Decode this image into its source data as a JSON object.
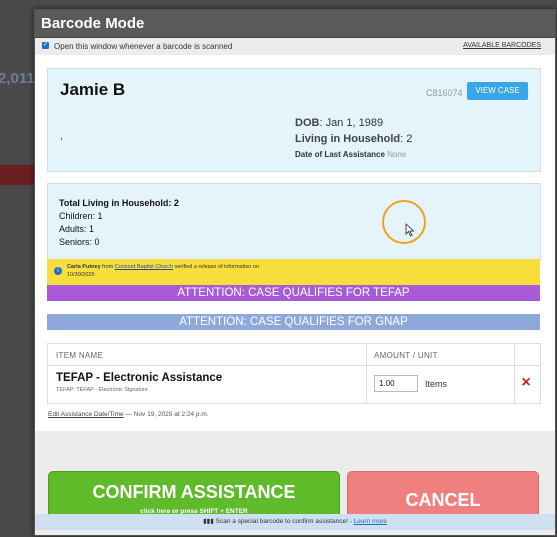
{
  "modal": {
    "title": "Barcode Mode",
    "open_window_label": "Open this window whenever a barcode is scanned",
    "available_barcodes": "AVAILABLE BARCODES"
  },
  "client": {
    "name": "Jamie B",
    "case_id": "C816074",
    "view_case": "VIEW CASE",
    "comma": ",",
    "dob_label": "DOB",
    "dob_value": ": Jan 1, 1989",
    "living_label": "Living in Household",
    "living_value": ": 2",
    "last_assistance_label": "Date of Last Assistance",
    "last_assistance_value": " None"
  },
  "household": {
    "total": "Total Living in Household: 2",
    "children": "Children: 1",
    "adults": "Adults: 1",
    "seniors": "Seniors: 0"
  },
  "notice": {
    "name": "Carla Putney",
    "from": " from ",
    "org": "Concord Baptist Church",
    "text": " verified a release of information on 10/30/2025"
  },
  "attention": {
    "tefap": "ATTENTION: CASE QUALIFIES FOR TEFAP",
    "gnap": "ATTENTION: CASE QUALIFIES FOR GNAP"
  },
  "table": {
    "col_item": "ITEM NAME",
    "col_amount": "AMOUNT / UNIT",
    "item_name": "TEFAP - Electronic Assistance",
    "item_sub": "TEFAP: TEFAP - Electronic Signature",
    "quantity": "1.00",
    "unit": "Items",
    "delete_icon": "×"
  },
  "edit": {
    "link": "Edit Assistance Date/Time",
    "sep": " — ",
    "timestamp": " Nov 19, 2025 at 2:24 p.m."
  },
  "buttons": {
    "confirm": "CONFIRM ASSISTANCE",
    "confirm_sub": "click here or press SHIFT + ENTER",
    "cancel": "CANCEL"
  },
  "bottom": {
    "text": "Scan a special barcode to confirm assistance!",
    "dash": " - ",
    "link": "Learn more"
  },
  "colors": {
    "tefap": "#a95ad8",
    "gnap": "#8ea8dc",
    "confirm": "#5fbb2a",
    "cancel": "#f08080"
  }
}
